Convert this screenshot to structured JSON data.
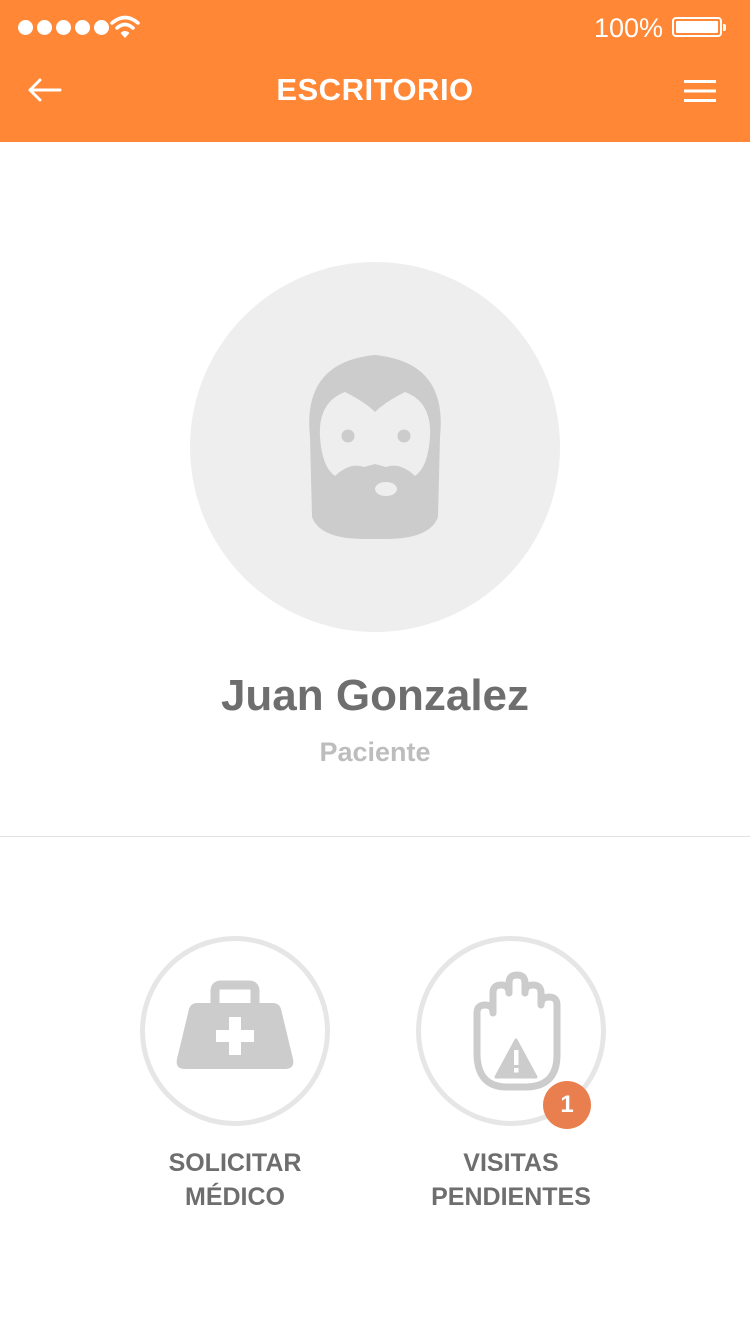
{
  "status_bar": {
    "signal_strength": 5,
    "wifi_icon": "wifi-icon",
    "battery_text": "100%",
    "battery_level": 1.0
  },
  "header": {
    "title": "ESCRITORIO",
    "back_icon": "arrow-left-icon",
    "menu_icon": "hamburger-menu-icon",
    "background_color": "#FF8736"
  },
  "profile": {
    "avatar_icon": "bearded-man-avatar-icon",
    "name": "Juan Gonzalez",
    "role": "Paciente"
  },
  "actions": [
    {
      "label_line1": "SOLICITAR",
      "label_line2": "MÉDICO",
      "icon": "medical-kit-icon"
    },
    {
      "label_line1": "VISITAS",
      "label_line2": "PENDIENTES",
      "icon": "hand-warning-icon",
      "badge": "1",
      "badge_color": "#E97F4E"
    }
  ]
}
